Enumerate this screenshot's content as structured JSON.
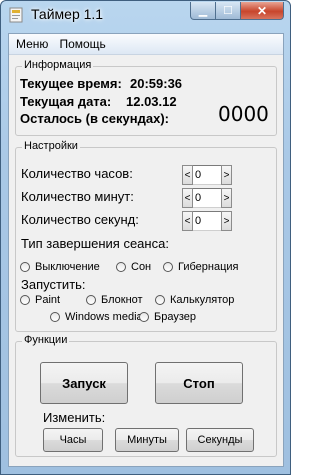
{
  "window": {
    "title": "Таймер 1.1"
  },
  "menu": {
    "items": [
      "Меню",
      "Помощь"
    ]
  },
  "info": {
    "group_title": "Информация",
    "time_label": "Текущее время:",
    "time_value": "20:59:36",
    "date_label": "Текущая дата:",
    "date_value": "12.03.12",
    "remaining_label": "Осталось (в секундах):",
    "remaining_value": "0000"
  },
  "settings": {
    "group_title": "Настройки",
    "hours_label": "Количество часов:",
    "minutes_label": "Количество минут:",
    "seconds_label": "Количество секунд:",
    "hours_value": "0",
    "minutes_value": "0",
    "seconds_value": "0",
    "spin_left": "<",
    "spin_right": ">",
    "end_type_label": "Тип завершения сеанса:",
    "end_options": [
      "Выключение",
      "Сон",
      "Гибернация"
    ],
    "launch_label": "Запустить:",
    "launch_options": [
      "Paint",
      "Блокнот",
      "Калькулятор",
      "Windows media",
      "Браузер"
    ]
  },
  "functions": {
    "group_title": "Функции",
    "start_label": "Запуск",
    "stop_label": "Стоп",
    "change_label": "Изменить:",
    "hours_btn": "Часы",
    "minutes_btn": "Минуты",
    "seconds_btn": "Секунды"
  }
}
